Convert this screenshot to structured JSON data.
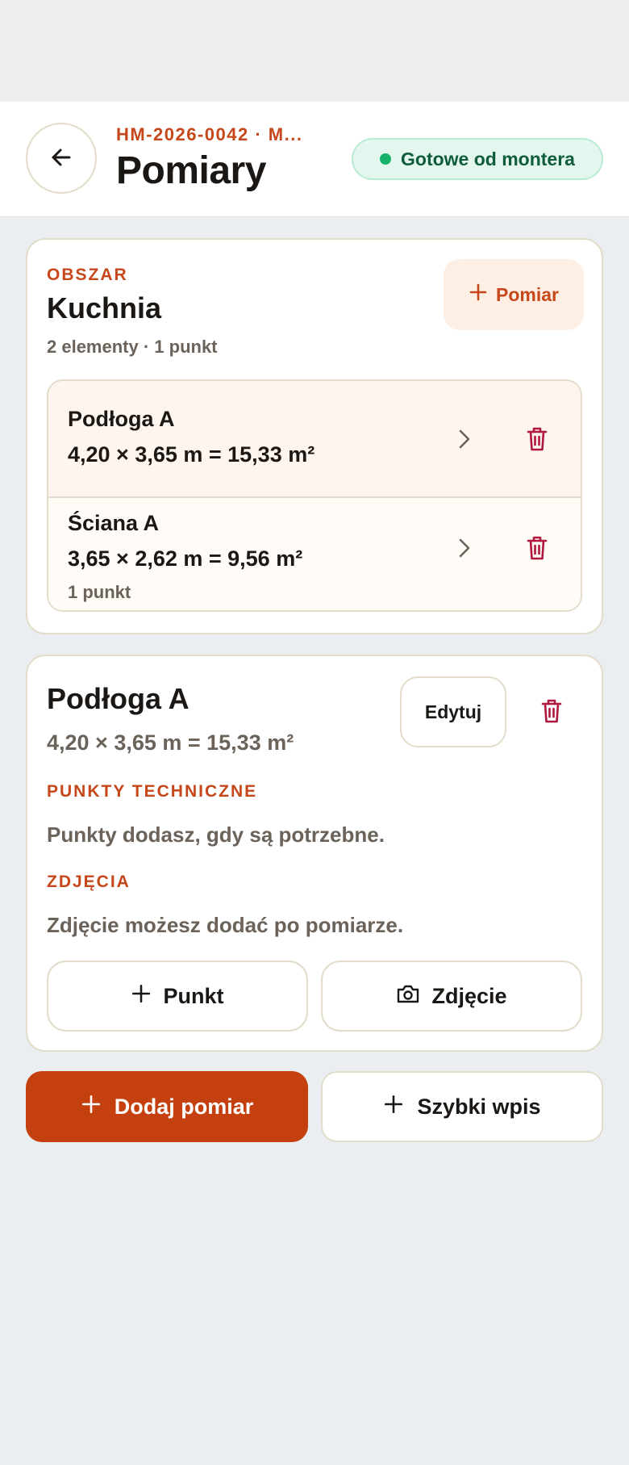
{
  "header": {
    "subtitle": "HM-2026-0042 · M...",
    "title": "Pomiary",
    "status": "Gotowe od montera",
    "back_icon": "arrow-left-icon"
  },
  "area": {
    "eyebrow": "OBSZAR",
    "name": "Kuchnia",
    "meta": "2 elementy · 1 punkt",
    "add_button": "Pomiar",
    "elements": [
      {
        "name": "Podłoga A",
        "dims": "4,20 × 3,65 m = 15,33 m²",
        "points": ""
      },
      {
        "name": "Ściana A",
        "dims": "3,65 × 2,62 m = 9,56 m²",
        "points": "1 punkt"
      }
    ]
  },
  "detail": {
    "title": "Podłoga A",
    "dims": "4,20 × 3,65 m = 15,33 m²",
    "edit_button": "Edytuj",
    "points_heading": "PUNKTY TECHNICZNE",
    "points_empty": "Punkty dodasz, gdy są potrzebne.",
    "photos_heading": "ZDJĘCIA",
    "photos_empty": "Zdjęcie możesz dodać po pomiarze.",
    "point_button": "Punkt",
    "photo_button": "Zdjęcie"
  },
  "actions": {
    "add_measure": "Dodaj pomiar",
    "quick_entry": "Szybki wpis"
  },
  "colors": {
    "accent": "#c4410f",
    "danger": "#b0173f",
    "success": "#17b26a"
  }
}
